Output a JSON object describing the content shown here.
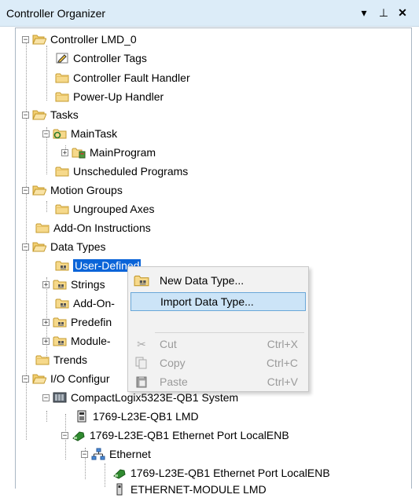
{
  "panel": {
    "title": "Controller Organizer",
    "controls": {
      "dropdown": "▾",
      "pin": "⊥",
      "close": "✕"
    }
  },
  "tree": {
    "controller": "Controller LMD_0",
    "controller_tags": "Controller Tags",
    "fault_handler": "Controller Fault Handler",
    "powerup_handler": "Power-Up Handler",
    "tasks": "Tasks",
    "main_task": "MainTask",
    "main_program": "MainProgram",
    "unscheduled": "Unscheduled Programs",
    "motion_groups": "Motion Groups",
    "ungrouped_axes": "Ungrouped Axes",
    "addon_instructions": "Add-On Instructions",
    "data_types": "Data Types",
    "user_defined": "User-Defined",
    "strings": "Strings",
    "addon_types": "Add-On-",
    "predefined": "Predefin",
    "module_defined": "Module-",
    "trends": "Trends",
    "io_config": "I/O Configur",
    "system": "CompactLogix5323E-QB1 System",
    "lmd": "1769-L23E-QB1 LMD",
    "eth_port": "1769-L23E-QB1 Ethernet Port LocalENB",
    "ethernet": "Ethernet",
    "eth_port_child": "1769-L23E-QB1 Ethernet Port LocalENB",
    "eth_module": "ETHERNET-MODULE LMD"
  },
  "context_menu": {
    "new_type": "New Data Type...",
    "import_type": "Import Data Type...",
    "cut": "Cut",
    "cut_key": "Ctrl+X",
    "copy": "Copy",
    "copy_key": "Ctrl+C",
    "paste": "Paste",
    "paste_key": "Ctrl+V"
  }
}
